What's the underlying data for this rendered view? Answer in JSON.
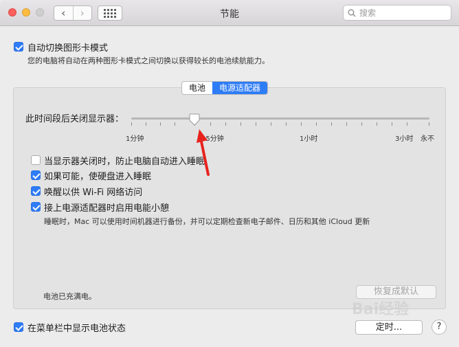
{
  "window": {
    "title": "节能"
  },
  "toolbar": {
    "back_icon": "chevron-left-icon",
    "forward_icon": "chevron-right-icon",
    "grid_icon": "show-all-icon",
    "search_placeholder": "搜索"
  },
  "auto_graphics": {
    "checked": true,
    "label": "自动切换图形卡模式",
    "description": "您的电脑将自动在两种图形卡模式之间切换以获得较长的电池续航能力。"
  },
  "tabs": [
    {
      "label": "电池",
      "active": false
    },
    {
      "label": "电源适配器",
      "active": true
    }
  ],
  "display_sleep": {
    "label": "此时间段后关闭显示器：",
    "ticks": [
      "1分钟",
      "15分钟",
      "1小时",
      "3小时",
      "永不"
    ],
    "value": "15分钟"
  },
  "options": [
    {
      "checked": false,
      "label": "当显示器关闭时，防止电脑自动进入睡眠"
    },
    {
      "checked": true,
      "label": "如果可能，使硬盘进入睡眠"
    },
    {
      "checked": true,
      "label": "唤醒以供 Wi-Fi 网络访问"
    },
    {
      "checked": true,
      "label": "接上电源适配器时启用电能小憩"
    }
  ],
  "power_nap_note": "睡眠时，Mac 可以使用时间机器进行备份，并可以定期检查新电子邮件、日历和其他 iCloud 更新",
  "battery_status": "电池已充满电。",
  "restore_defaults_label": "恢复成默认",
  "show_battery_menu": {
    "checked": true,
    "label": "在菜单栏中显示电池状态"
  },
  "schedule_label": "定时...",
  "help_label": "?",
  "watermark_text": "Bai经验",
  "colors": {
    "accent": "#2e7cf6",
    "annotation_arrow": "#e8231e"
  }
}
